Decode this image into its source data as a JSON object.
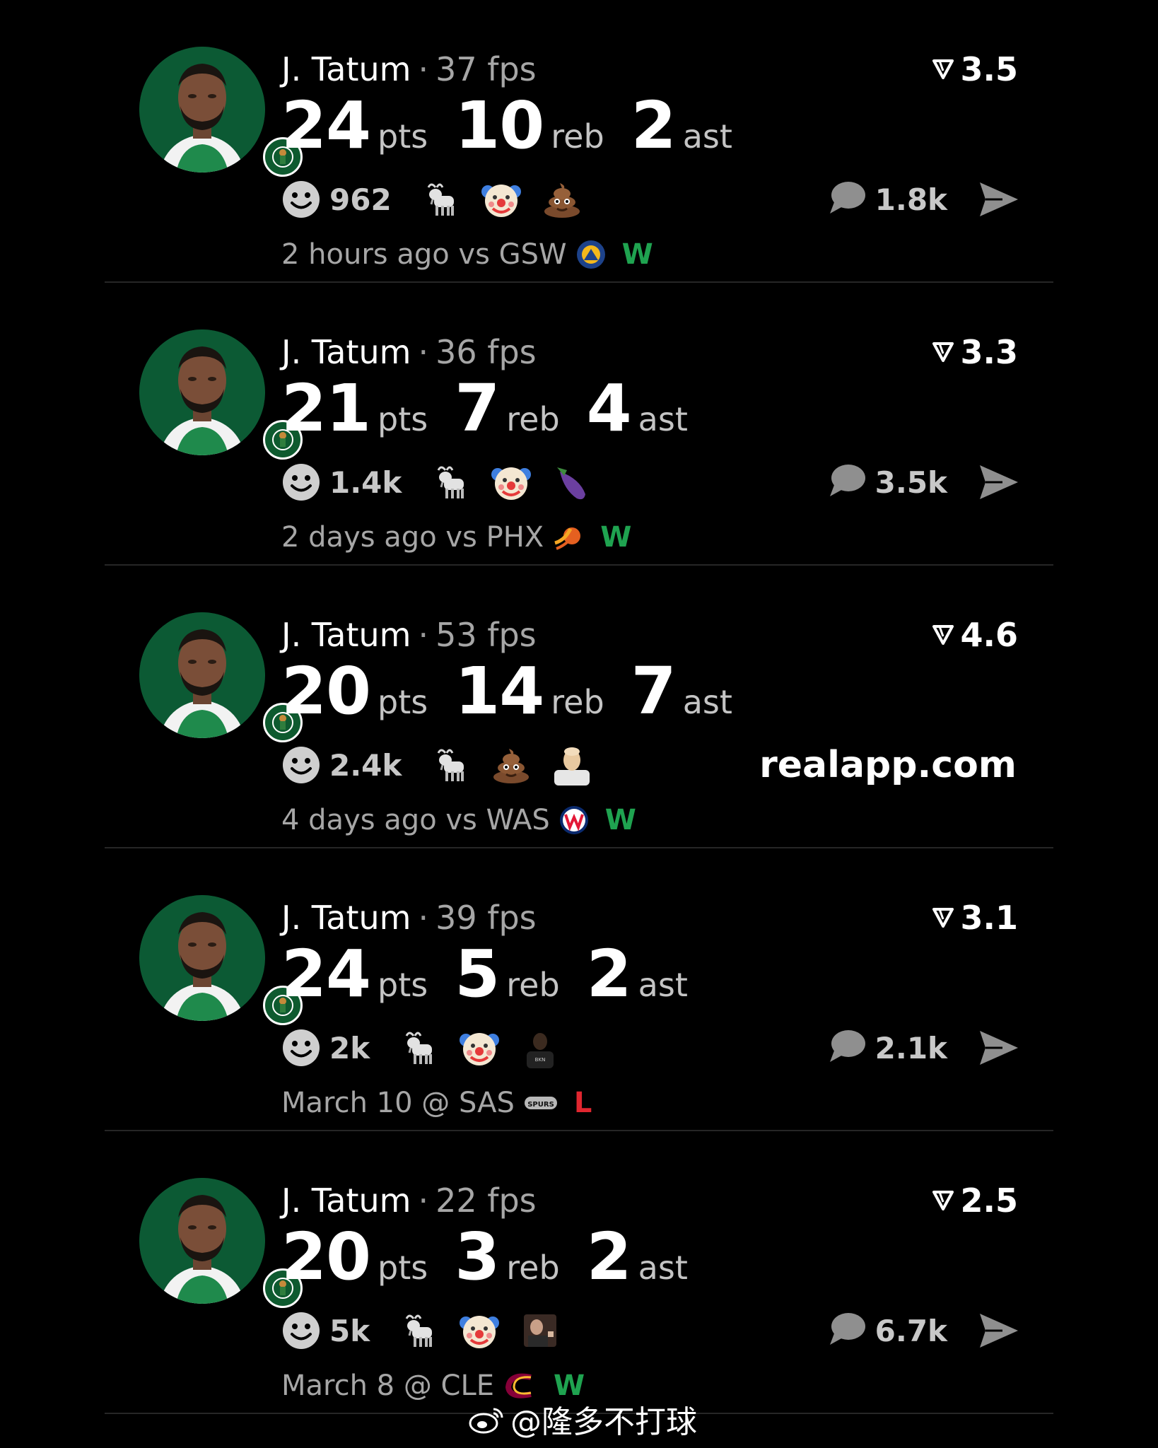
{
  "feed": [
    {
      "player": "J. Tatum",
      "separator": "·",
      "fps": "37 fps",
      "rating": "3.5",
      "stats": [
        {
          "value": "24",
          "label": "pts"
        },
        {
          "value": "10",
          "label": "reb"
        },
        {
          "value": "2",
          "label": "ast"
        }
      ],
      "reaction_count": "962",
      "reactions": [
        "goat-icon",
        "clown-icon",
        "poop-icon"
      ],
      "comments": "1.8k",
      "game": "2 hours ago vs GSW",
      "team_logo": "warriors-logo-icon",
      "result": "W",
      "result_color": "#1fa350"
    },
    {
      "player": "J. Tatum",
      "separator": "·",
      "fps": "36 fps",
      "rating": "3.3",
      "stats": [
        {
          "value": "21",
          "label": "pts"
        },
        {
          "value": "7",
          "label": "reb"
        },
        {
          "value": "4",
          "label": "ast"
        }
      ],
      "reaction_count": "1.4k",
      "reactions": [
        "goat-icon",
        "clown-icon",
        "eggplant-icon"
      ],
      "comments": "3.5k",
      "game": "2 days ago vs PHX",
      "team_logo": "suns-logo-icon",
      "result": "W",
      "result_color": "#1fa350"
    },
    {
      "player": "J. Tatum",
      "separator": "·",
      "fps": "53 fps",
      "rating": "4.6",
      "stats": [
        {
          "value": "20",
          "label": "pts"
        },
        {
          "value": "14",
          "label": "reb"
        },
        {
          "value": "7",
          "label": "ast"
        }
      ],
      "reaction_count": "2.4k",
      "reactions": [
        "goat-icon",
        "poop-icon",
        "bald-man-icon"
      ],
      "promo": "realapp.com",
      "game": "4 days ago vs WAS",
      "team_logo": "wizards-logo-icon",
      "result": "W",
      "result_color": "#1fa350"
    },
    {
      "player": "J. Tatum",
      "separator": "·",
      "fps": "39 fps",
      "rating": "3.1",
      "stats": [
        {
          "value": "24",
          "label": "pts"
        },
        {
          "value": "5",
          "label": "reb"
        },
        {
          "value": "2",
          "label": "ast"
        }
      ],
      "reaction_count": "2k",
      "reactions": [
        "goat-icon",
        "clown-icon",
        "nets-player-icon"
      ],
      "comments": "2.1k",
      "game": "March 10 @ SAS",
      "team_logo": "spurs-logo-icon",
      "result": "L",
      "result_color": "#e0262f"
    },
    {
      "player": "J. Tatum",
      "separator": "·",
      "fps": "22 fps",
      "rating": "2.5",
      "stats": [
        {
          "value": "20",
          "label": "pts"
        },
        {
          "value": "3",
          "label": "reb"
        },
        {
          "value": "2",
          "label": "ast"
        }
      ],
      "reaction_count": "5k",
      "reactions": [
        "goat-icon",
        "clown-icon",
        "man-photo-icon"
      ],
      "comments": "6.7k",
      "game": "March 8 @ CLE",
      "team_logo": "cavaliers-logo-icon",
      "result": "W",
      "result_color": "#1fa350"
    }
  ],
  "watermark": "@隆多不打球",
  "colors": {
    "background": "#000000",
    "avatar_bg": "#0c5a34",
    "win": "#1fa350",
    "loss": "#e0262f",
    "muted_text": "#a6a6a6"
  }
}
